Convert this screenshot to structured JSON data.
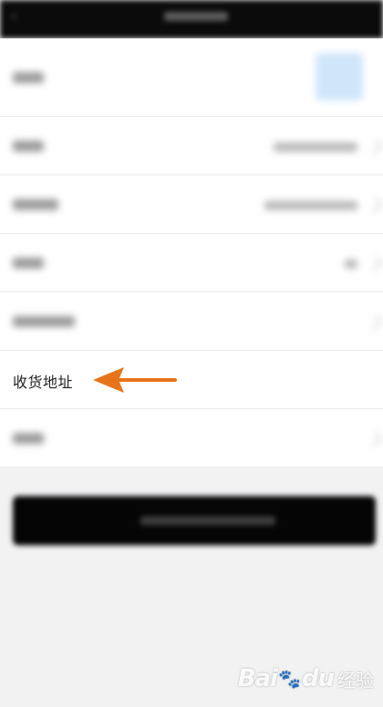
{
  "header": {
    "title": "",
    "back_icon": "back-arrow-icon"
  },
  "profile_rows": {
    "address_label": "收货地址"
  },
  "annotation": {
    "arrow_color": "#e8741a",
    "arrow_icon": "left-arrow-icon"
  },
  "bottom_button": {
    "label": ""
  },
  "watermark": {
    "logo": "Bai",
    "paw": "du",
    "text": "经验"
  },
  "colors": {
    "header_bg": "#0b0b0b",
    "page_bg": "#f2f2f3",
    "row_bg": "#ffffff",
    "button_bg": "#050505"
  }
}
